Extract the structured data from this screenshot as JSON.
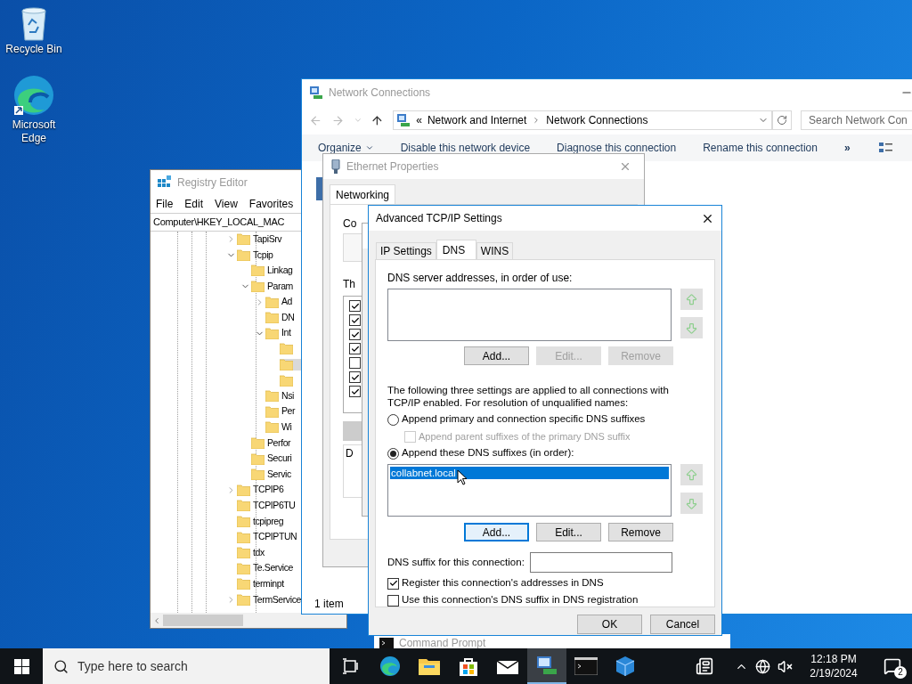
{
  "desktop_icons": [
    {
      "label": "Recycle Bin",
      "kind": "recycle"
    },
    {
      "label": "Microsoft Edge",
      "kind": "edge"
    }
  ],
  "registry_editor": {
    "title": "Registry Editor",
    "menu": [
      "File",
      "Edit",
      "View",
      "Favorites"
    ],
    "address": "Computer\\HKEY_LOCAL_MAC",
    "tree": [
      {
        "label": "TapiSrv",
        "expanded": false,
        "selected": false
      },
      {
        "label": "Tcpip",
        "expanded": true,
        "selected": false,
        "children": [
          {
            "label": "Linkag",
            "selected": false
          },
          {
            "label": "Param",
            "expanded": true,
            "selected": false,
            "children": [
              {
                "label": "Ad",
                "expanded": false,
                "selected": false
              },
              {
                "label": "DN",
                "selected": false
              },
              {
                "label": "Int",
                "expanded": true,
                "selected": false,
                "children": [
                  {
                    "selected": false
                  },
                  {
                    "selected": true
                  },
                  {
                    "selected": false
                  }
                ]
              },
              {
                "label": "Nsi",
                "selected": false
              },
              {
                "label": "Per",
                "selected": false
              },
              {
                "label": "Wi",
                "selected": false
              }
            ]
          },
          {
            "label": "Perfor",
            "selected": false
          },
          {
            "label": "Securi",
            "selected": false
          },
          {
            "label": "Servic",
            "selected": false
          }
        ]
      },
      {
        "label": "TCPIP6",
        "expanded": false,
        "selected": false
      },
      {
        "label": "TCPIP6TU",
        "selected": false
      },
      {
        "label": "tcpipreg",
        "selected": false
      },
      {
        "label": "TCPIPTUN",
        "selected": false
      },
      {
        "label": "tdx",
        "selected": false
      },
      {
        "label": "Te.Service",
        "selected": false
      },
      {
        "label": "terminpt",
        "selected": false
      },
      {
        "label": "TermService",
        "expanded": false,
        "selected": false
      }
    ]
  },
  "network_connections": {
    "title": "Network Connections",
    "breadcrumb": [
      "«",
      "Network and Internet",
      "Network Connections"
    ],
    "search": {
      "placeholder": "Search Network Con"
    },
    "toolbar": [
      {
        "label": "Organize",
        "kind": "menu"
      },
      {
        "label": "Disable this network device",
        "kind": "command"
      },
      {
        "label": "Diagnose this connection",
        "kind": "command"
      },
      {
        "label": "Rename this connection",
        "kind": "command"
      },
      {
        "label": "»",
        "kind": "more"
      }
    ],
    "status": "1 item"
  },
  "ethernet_properties": {
    "title": "Ethernet Properties",
    "tabs": [
      {
        "label": "Networking",
        "selected": true
      }
    ],
    "connect_label": "Co",
    "items_label": "Th",
    "description_label": "D",
    "components": [
      {
        "checked": true
      },
      {
        "checked": true
      },
      {
        "checked": true
      },
      {
        "checked": true
      },
      {
        "checked": false
      },
      {
        "checked": true
      },
      {
        "checked": true
      }
    ]
  },
  "advanced_tcpip": {
    "title": "Advanced TCP/IP Settings",
    "tabs": [
      {
        "label": "IP Settings",
        "selected": false
      },
      {
        "label": "DNS",
        "selected": true
      },
      {
        "label": "WINS",
        "selected": false
      }
    ],
    "servers_label": "DNS server addresses, in order of use:",
    "server_arrows": [
      {
        "kind": "up",
        "disabled": true
      },
      {
        "kind": "down",
        "disabled": true
      }
    ],
    "server_buttons": [
      {
        "label": "Add...",
        "disabled": false,
        "focused": false
      },
      {
        "label": "Edit...",
        "disabled": true,
        "focused": false
      },
      {
        "label": "Remove",
        "disabled": true,
        "focused": false
      }
    ],
    "info": "The following three settings are applied to all connections with TCP/IP enabled. For resolution of unqualified names:",
    "options": [
      {
        "kind": "radio",
        "label": "Append primary and connection specific DNS suffixes",
        "checked": false,
        "disabled": false
      },
      {
        "kind": "checkbox",
        "label": "Append parent suffixes of the primary DNS suffix",
        "checked": false,
        "disabled": true
      },
      {
        "kind": "radio",
        "label": "Append these DNS suffixes (in order):",
        "checked": true,
        "disabled": false
      }
    ],
    "suffixes": [
      {
        "label": "collabnet.local",
        "selected": true
      }
    ],
    "suffix_arrows": [
      {
        "kind": "up",
        "disabled": true
      },
      {
        "kind": "down",
        "disabled": true
      }
    ],
    "suffix_buttons": [
      {
        "label": "Add...",
        "disabled": false,
        "focused": true
      },
      {
        "label": "Edit...",
        "disabled": false,
        "focused": false
      },
      {
        "label": "Remove",
        "disabled": false,
        "focused": false
      }
    ],
    "connection_suffix_label": "DNS suffix for this connection:",
    "register_options": [
      {
        "label": "Register this connection's addresses in DNS",
        "checked": true
      },
      {
        "label": "Use this connection's DNS suffix in DNS registration",
        "checked": false
      }
    ],
    "footer_buttons": [
      "OK",
      "Cancel"
    ]
  },
  "command_prompt": {
    "title": "Command Prompt"
  },
  "taskbar": {
    "search": {
      "placeholder": "Type here to search"
    },
    "apps": [
      {
        "kind": "taskview",
        "selected": false
      },
      {
        "kind": "edge",
        "selected": false
      },
      {
        "kind": "folder",
        "selected": false
      },
      {
        "kind": "store",
        "selected": false
      },
      {
        "kind": "mail",
        "selected": false
      },
      {
        "kind": "network",
        "selected": true
      },
      {
        "kind": "cmd",
        "selected": false
      },
      {
        "kind": "cube",
        "selected": false
      }
    ],
    "time": "12:18 PM",
    "date": "2/19/2024",
    "notifications": "2"
  }
}
